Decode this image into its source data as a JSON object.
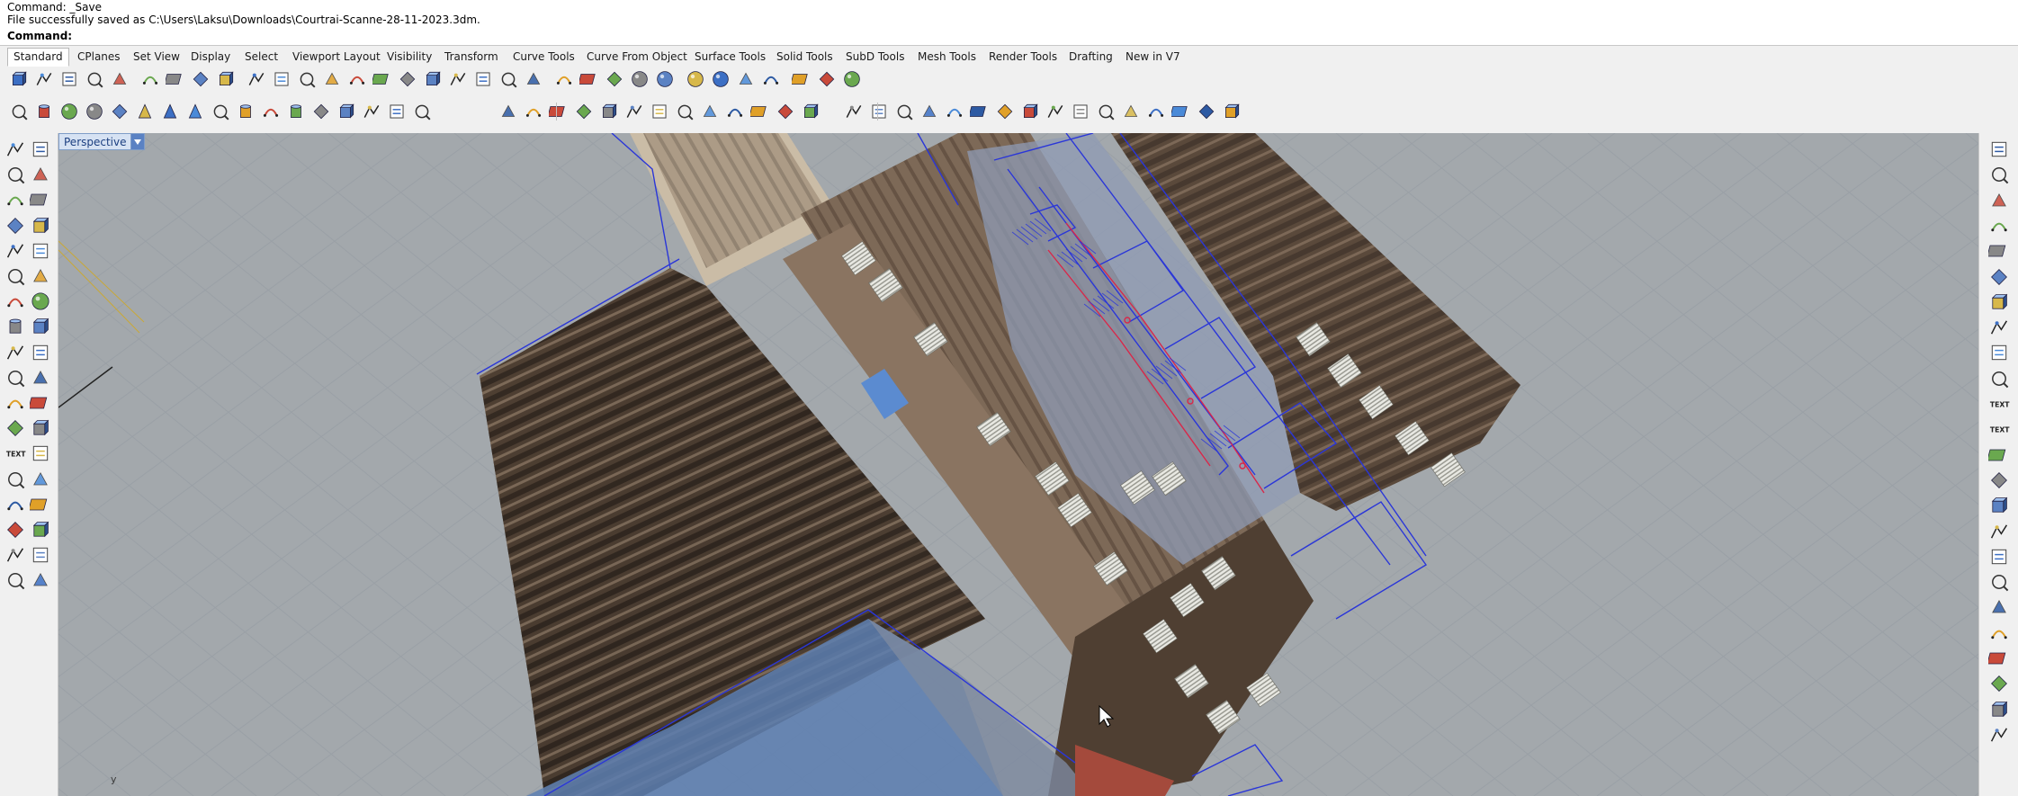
{
  "command_history": [
    "Command: _Save",
    "File successfully saved as C:\\Users\\Laksu\\Downloads\\Courtrai-Scanne-28-11-2023.3dm."
  ],
  "command_prompt": {
    "label": "Command:",
    "value": ""
  },
  "tabs": [
    "Standard",
    "CPlanes",
    "Set View",
    "Display",
    "Select",
    "Viewport Layout",
    "Visibility",
    "Transform",
    "Curve Tools",
    "Curve From Object",
    "Surface Tools",
    "Solid Tools",
    "SubD Tools",
    "Mesh Tools",
    "Render Tools",
    "Drafting",
    "New in V7"
  ],
  "active_tab": "Standard",
  "viewport": {
    "name": "Perspective",
    "axis_label": "y"
  },
  "colors": {
    "viewport_bg": "#a3a8ac",
    "grid": "#9aa0a6",
    "accent": "#5b82c3",
    "scan_dark": "#4a3a2c",
    "scan_light": "#b7a48c",
    "curve_blue": "#2233dd",
    "curve_red": "#dd2233"
  },
  "toolbar_row1_icons": [
    "new-icon",
    "open-icon",
    "save-icon",
    "print-icon",
    "import-icon",
    "cut-icon",
    "copy-icon",
    "paste-icon",
    "undo-icon",
    "pan-icon",
    "rotate-view-icon",
    "zoom-icon",
    "zoom-window-icon",
    "zoom-extents-icon",
    "zoom-selected-icon",
    "zoom-extents-all-icon",
    "four-viewports-icon",
    "car-icon",
    "hide-icon",
    "show-icon",
    "lights-icon",
    "lock-icon",
    "layers-icon",
    "render-icon",
    "color-wheel-icon",
    "sphere-grey-icon",
    "sphere-dark-icon",
    "sphere-blue-icon",
    "wand-icon",
    "gear-icon",
    "properties-icon",
    "sun-icon",
    "help-icon"
  ],
  "toolbar_row2_icons": [
    "box-icon",
    "cylinder-icon",
    "sphere-icon",
    "ellipsoid-icon",
    "paraboloid-icon",
    "cone-icon",
    "truncated-cone-icon",
    "pyramid-icon",
    "plane-solid-icon",
    "tube-icon",
    "torus-icon",
    "pipe-icon",
    "extrude-icon",
    "slab-icon",
    "solid-array-icon",
    "extrude-curve-icon",
    "extrude-straight-icon",
    "extrude-tapered-icon",
    "extrude-path-icon",
    "extrude-point-icon",
    "extrude-ribbon-icon",
    "extrude-surface-icon",
    "extrude-srf-point-icon",
    "offset-icon",
    "fillet-edge-icon",
    "boolean-union-icon",
    "boolean-diff-icon",
    "boolean-intersect-icon",
    "boolean-split-icon",
    "cap-icon",
    "explode-icon",
    "extract-icon",
    "merge-icon",
    "shell-icon",
    "wire-cut-icon",
    "fillet-icon",
    "variable-fillet-icon",
    "chamfer-icon",
    "blend-icon",
    "move-face-icon",
    "mesh-icon",
    "mesh-box-icon",
    "grid-mesh-icon",
    "array-points-icon",
    "layout-icon",
    "history-icon"
  ],
  "left_tools": [
    "select-icon",
    "point-icon",
    "polyline-icon",
    "curve-icon",
    "circle-icon",
    "ellipse-icon",
    "polygon-icon",
    "rectangle-icon",
    "arc-icon",
    "free-curve-icon",
    "surface-icon",
    "loft-icon",
    "box-solid-icon",
    "sphere-solid-icon",
    "cylinder-solid-icon",
    "plane-surface-icon",
    "fillet-tool-icon",
    "trim-tool-icon",
    "move-tool-icon",
    "copy-tool-icon",
    "paint-icon",
    "point-cloud-icon",
    "rotate-tool-icon",
    "scale-tool-icon",
    "text-tool-icon",
    "dimension-tool-icon",
    "group-icon",
    "block-icon",
    "mesh-tool-icon",
    "analyze-icon",
    "array-tool-icon",
    "mirror-tool-icon",
    "check-icon",
    "join-icon",
    "render-tool-icon",
    "material-icon"
  ],
  "right_tools": [
    "osnap-end-icon",
    "osnap-near-icon",
    "osnap-mid-icon",
    "osnap-cen-icon",
    "osnap-int-icon",
    "osnap-perp-icon",
    "osnap-tan-icon",
    "osnap-quad-icon",
    "osnap-knot-icon",
    "osnap-vertex-icon",
    "text-icon",
    "text-outline-icon",
    "dimension-icon",
    "leader-icon",
    "tolerance-icon",
    "hatch-icon",
    "layer-icon",
    "annotate-icon",
    "block-manager-icon",
    "named-view-icon",
    "open-folder-icon",
    "material-ball-icon",
    "snapshot-icon",
    "layout-mgr-icon"
  ],
  "right_text_labels": [
    "TEXT",
    "TEXT"
  ]
}
